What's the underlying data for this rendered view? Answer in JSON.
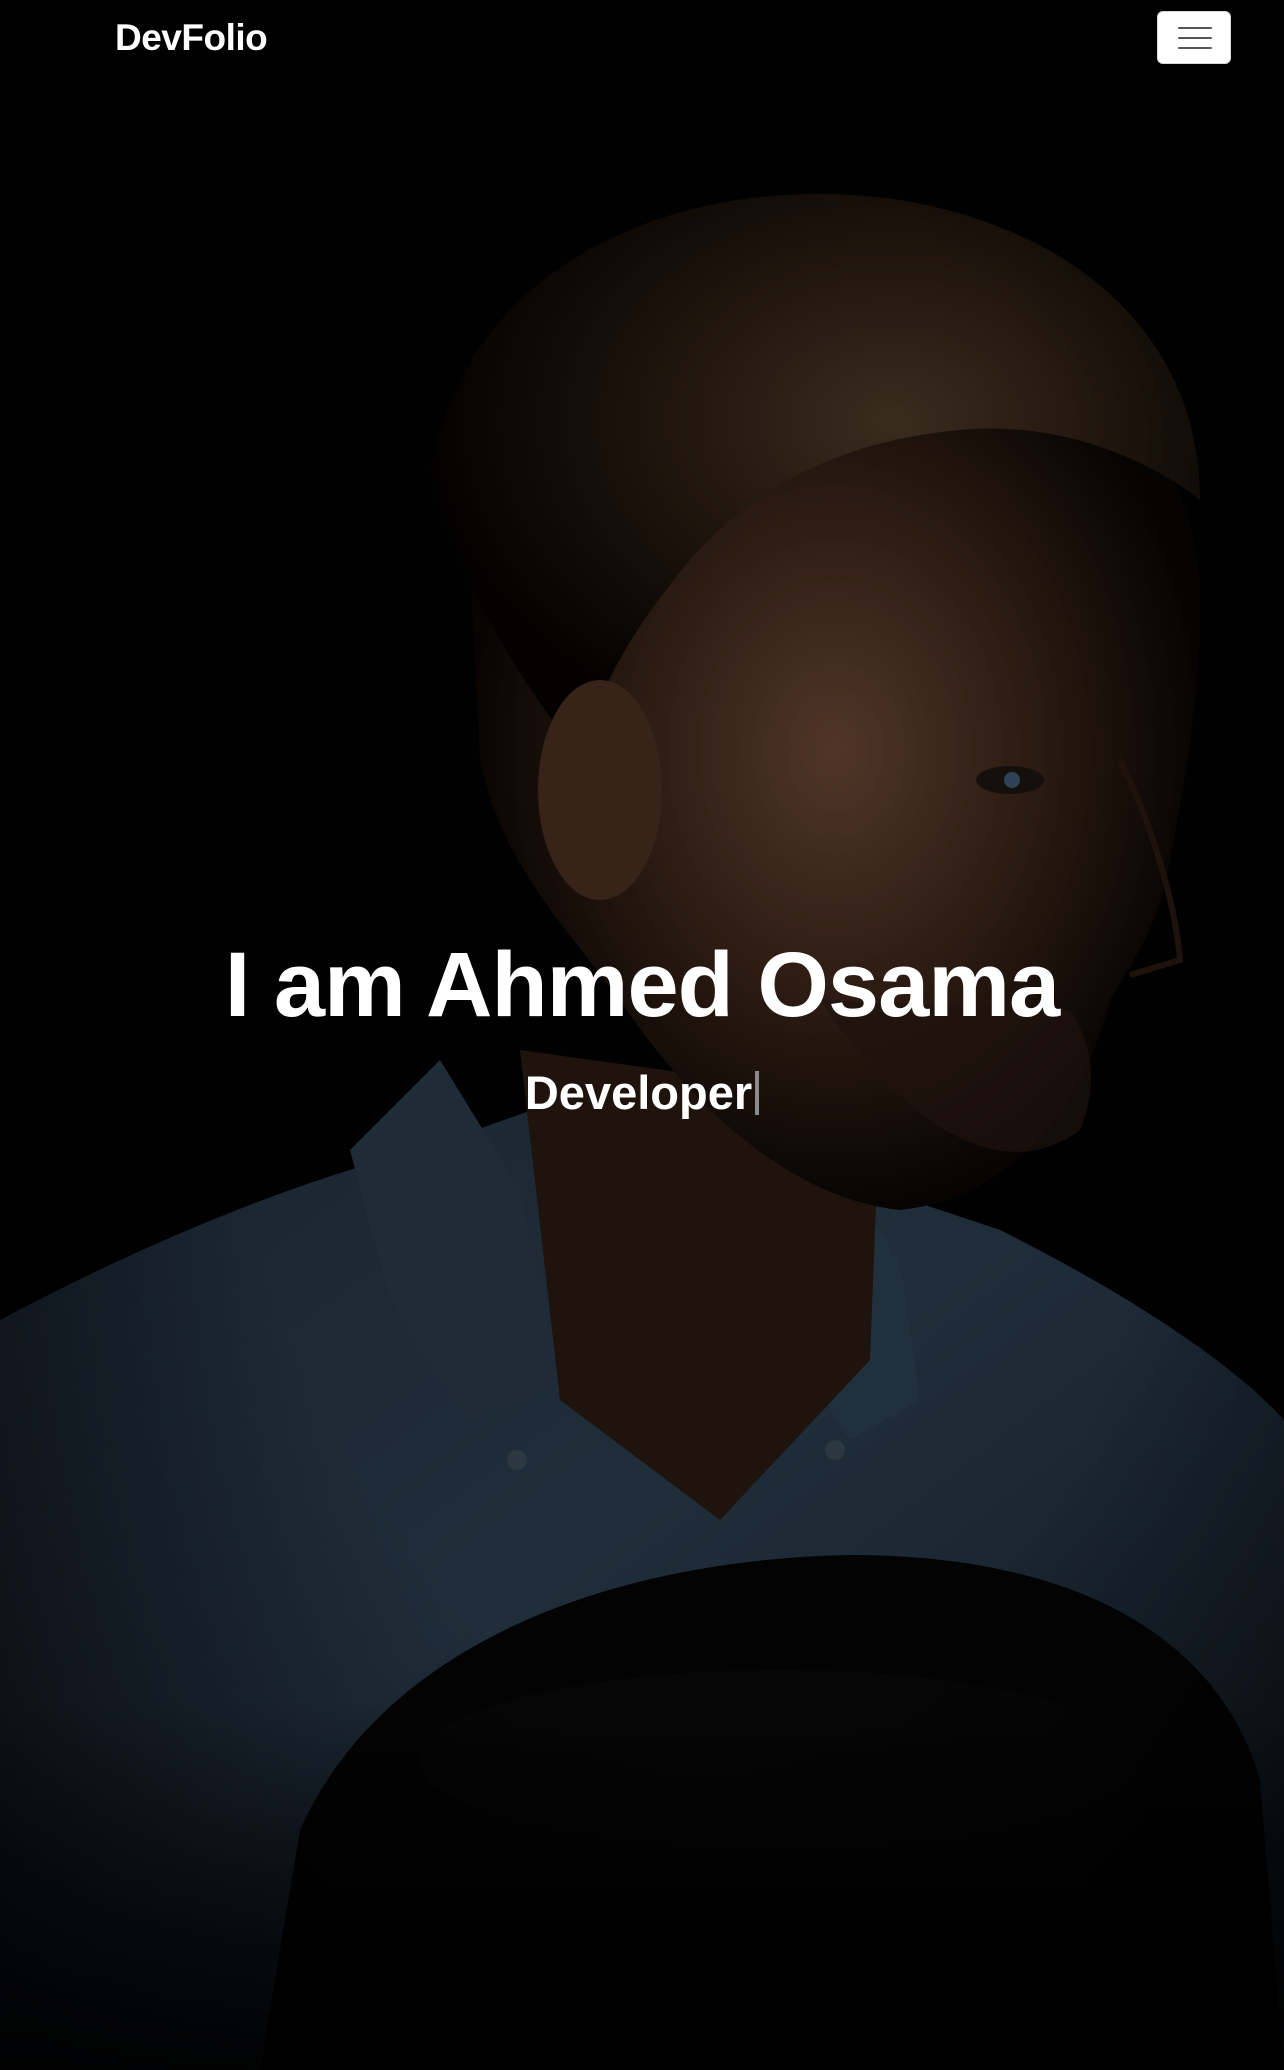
{
  "navbar": {
    "brand": "DevFolio",
    "toggle_icon": "hamburger-menu-icon"
  },
  "hero": {
    "title": "I am Ahmed Osama",
    "subtitle": "Developer",
    "background": "dark portrait photo with overlay"
  },
  "colors": {
    "background": "#000000",
    "text": "#ffffff",
    "toggle_bg": "#ffffff",
    "toggle_bars": "#555555"
  }
}
